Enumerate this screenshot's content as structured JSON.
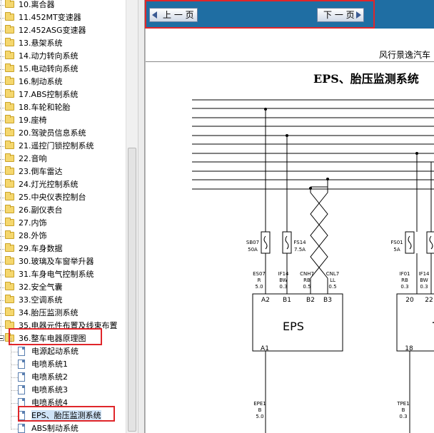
{
  "tree": {
    "folders": [
      "10.离合器",
      "11.452MT变速器",
      "12.452ASG变速器",
      "13.悬架系统",
      "14.动力转向系统",
      "15.电动转向系统",
      "16.制动系统",
      "17.ABS控制系统",
      "18.车轮和轮胎",
      "19.座椅",
      "20.驾驶员信息系统",
      "21.遥控门锁控制系统",
      "22.音响",
      "23.倒车雷达",
      "24.灯光控制系统",
      "25.中央仪表控制台",
      "26.副仪表台",
      "27.内饰",
      "28.外饰",
      "29.车身数据",
      "30.玻璃及车窗举升器",
      "31.车身电气控制系统",
      "32.安全气囊",
      "33.空调系统",
      "34.胎压监测系统",
      "35.电器元件布置及线束布置"
    ],
    "expanded_folder": "36.整车电器原理图",
    "children": [
      "电源起动系统",
      "电喷系统1",
      "电喷系统2",
      "电喷系统3",
      "电喷系统4",
      "EPS、胎压监测系统",
      "ABS制动系统"
    ],
    "selected_child": "EPS、胎压监测系统"
  },
  "toolbar": {
    "prev_label": "上 一 页",
    "next_label": "下 一 页",
    "background": "#1f6ea3"
  },
  "document": {
    "company": "风行景逸汽车",
    "title": "EPS、胎压监测系统",
    "fuses": [
      {
        "name": "SB07",
        "rating": "50A"
      },
      {
        "name": "FS14",
        "rating": "7.5A"
      },
      {
        "name": "FS01",
        "rating": "5A"
      }
    ],
    "wires": [
      {
        "id": "ES07",
        "color": "R",
        "gauge": "5.0"
      },
      {
        "id": "IF14",
        "color": "BW",
        "gauge": "0.3"
      },
      {
        "id": "CNH7",
        "color": "RB",
        "gauge": "0.5"
      },
      {
        "id": "CNL7",
        "color": "LL",
        "gauge": "0.5"
      },
      {
        "id": "IF01",
        "color": "RB",
        "gauge": "0.3"
      },
      {
        "id": "IF14",
        "color": "BW",
        "gauge": "0.3"
      }
    ],
    "module_left": {
      "name": "EPS",
      "pins_top": [
        "A2",
        "B1",
        "B2",
        "B3"
      ],
      "pin_bottom": "A1"
    },
    "module_right": {
      "name": "T",
      "pins_top": [
        "20",
        "22"
      ],
      "pin_bottom": "18"
    },
    "ground_left": {
      "id": "EPE1",
      "color": "B",
      "gauge": "5.0"
    },
    "ground_right": {
      "id": "TPE1",
      "color": "B",
      "gauge": "0.3"
    }
  }
}
